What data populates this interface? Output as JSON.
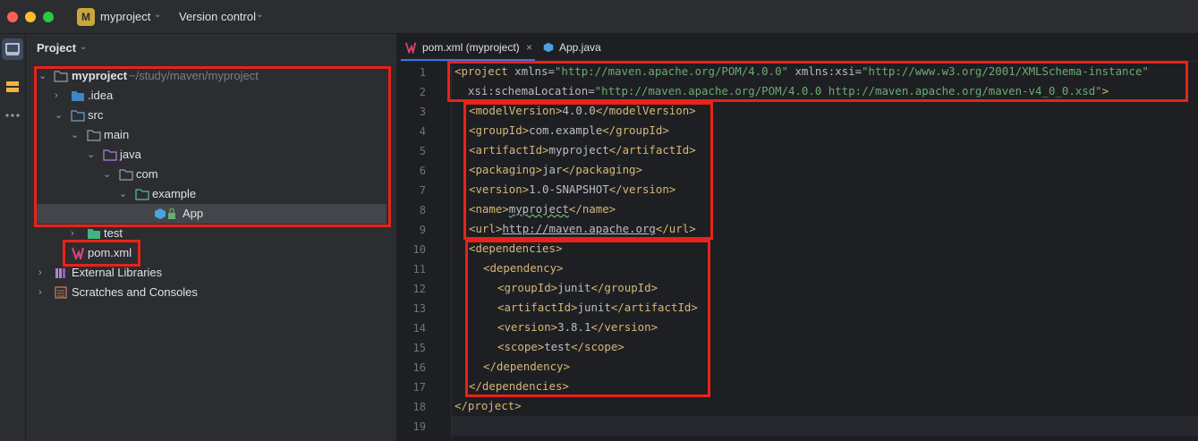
{
  "titlebar": {
    "project_badge": "M",
    "project_name": "myproject",
    "vcs_label": "Version control"
  },
  "project_panel": {
    "title": "Project",
    "tree": [
      {
        "label": "myproject",
        "path": "~/study/maven/myproject",
        "icon": "folder-icon"
      },
      {
        "label": ".idea",
        "icon": "folder-icon"
      },
      {
        "label": "src",
        "icon": "source-folder-icon"
      },
      {
        "label": "main",
        "icon": "folder-icon"
      },
      {
        "label": "java",
        "icon": "java-source-root-icon"
      },
      {
        "label": "com",
        "icon": "package-folder-icon"
      },
      {
        "label": "example",
        "icon": "package-folder-icon"
      },
      {
        "label": "App",
        "icon": "java-class-icon"
      },
      {
        "label": "test",
        "icon": "test-folder-icon"
      },
      {
        "label": "pom.xml",
        "icon": "maven-icon"
      },
      {
        "label": "External Libraries",
        "icon": "library-icon"
      },
      {
        "label": "Scratches and Consoles",
        "icon": "scratches-icon"
      }
    ]
  },
  "editor": {
    "tabs": [
      {
        "label": "pom.xml (myproject)",
        "close": "×"
      },
      {
        "label": "App.java"
      }
    ],
    "line_numbers": [
      "1",
      "2",
      "3",
      "4",
      "5",
      "6",
      "7",
      "8",
      "9",
      "10",
      "11",
      "12",
      "13",
      "14",
      "15",
      "16",
      "17",
      "18",
      "19"
    ],
    "code": {
      "l1": {
        "open": "<project",
        "a1": " xmlns",
        "eq1": "=",
        "v1": "\"http://maven.apache.org/POM/4.0.0\"",
        "a2": " xmlns:xsi",
        "eq2": "=",
        "v2": "\"http://www.w3.org/2001/XMLSchema-instance\""
      },
      "l2": {
        "a1": "  xsi:schemaLocation",
        "eq1": "=",
        "v1": "\"http://maven.apache.org/POM/4.0.0 http://maven.apache.org/maven-v4_0_0.xsd\"",
        "close": ">"
      },
      "l3": {
        "o": "<modelVersion>",
        "t": "4.0.0",
        "c": "</modelVersion>"
      },
      "l4": {
        "o": "<groupId>",
        "t": "com.example",
        "c": "</groupId>"
      },
      "l5": {
        "o": "<artifactId>",
        "t": "myproject",
        "c": "</artifactId>"
      },
      "l6": {
        "o": "<packaging>",
        "t": "jar",
        "c": "</packaging>"
      },
      "l7": {
        "o": "<version>",
        "t": "1.0-SNAPSHOT",
        "c": "</version>"
      },
      "l8": {
        "o": "<name>",
        "t": "myproject",
        "c": "</name>"
      },
      "l9": {
        "o": "<url>",
        "t": "http://maven.apache.org",
        "c": "</url>"
      },
      "l10": {
        "o": "<dependencies>"
      },
      "l11": {
        "o": "<dependency>"
      },
      "l12": {
        "o": "<groupId>",
        "t": "junit",
        "c": "</groupId>"
      },
      "l13": {
        "o": "<artifactId>",
        "t": "junit",
        "c": "</artifactId>"
      },
      "l14": {
        "o": "<version>",
        "t": "3.8.1",
        "c": "</version>"
      },
      "l15": {
        "o": "<scope>",
        "t": "test",
        "c": "</scope>"
      },
      "l16": {
        "c": "</dependency>"
      },
      "l17": {
        "c": "</dependencies>"
      },
      "l18": {
        "c": "</project>"
      }
    }
  },
  "colors": {
    "highlight": "#e8231a",
    "tag": "#d5b778",
    "attr_value": "#6aab73"
  }
}
